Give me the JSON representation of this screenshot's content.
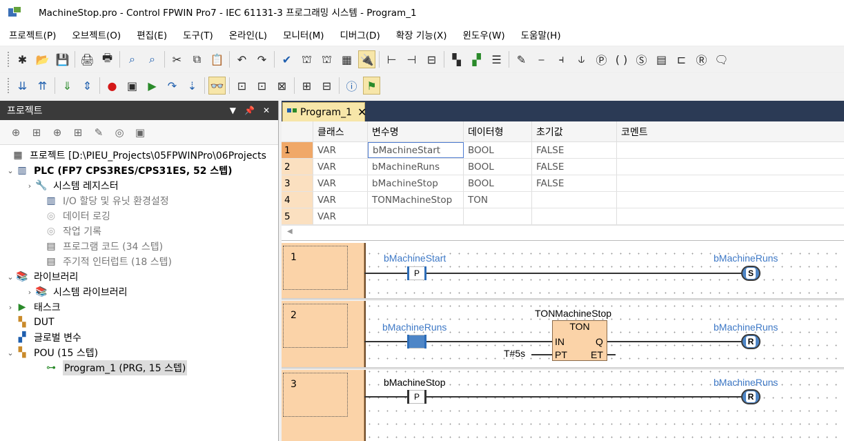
{
  "window": {
    "title": "MachineStop.pro - Control FPWIN Pro7 - IEC 61131-3 프로그래밍 시스템 - Program_1"
  },
  "menu": [
    "프로젝트(P)",
    "오브젝트(O)",
    "편집(E)",
    "도구(T)",
    "온라인(L)",
    "모니터(M)",
    "디버그(D)",
    "확장 기능(X)",
    "윈도우(W)",
    "도움말(H)"
  ],
  "project_panel": {
    "title": "프로젝트",
    "tree": [
      {
        "label": "프로젝트 [D:\\PIEU_Projects\\05FPWINPro\\06Projects",
        "bold": false,
        "icon": "project-icon"
      },
      {
        "label": "PLC (FP7 CPS3RES/CPS31ES, 52 스텝)",
        "bold": true,
        "icon": "plc-icon"
      },
      {
        "label": "시스템 레지스터",
        "bold": false,
        "icon": "wrench-folder-icon"
      },
      {
        "label": "I/O 할당 및 유닛 환경설정",
        "bold": false,
        "icon": "io-icon"
      },
      {
        "label": "데이터 로깅",
        "bold": false,
        "icon": "logging-icon"
      },
      {
        "label": "작업 기록",
        "bold": false,
        "icon": "record-icon"
      },
      {
        "label": "프로그램 코드 (34 스텝)",
        "bold": false,
        "icon": "code-icon"
      },
      {
        "label": "주기적 인터럽트 (18 스텝)",
        "bold": false,
        "icon": "interrupt-icon"
      },
      {
        "label": "라이브러리",
        "bold": false,
        "icon": "library-icon"
      },
      {
        "label": "시스템 라이브러리",
        "bold": false,
        "icon": "library-icon"
      },
      {
        "label": "태스크",
        "bold": false,
        "icon": "task-icon"
      },
      {
        "label": "DUT",
        "bold": false,
        "icon": "dut-icon"
      },
      {
        "label": "글로벌 변수",
        "bold": false,
        "icon": "global-var-icon"
      },
      {
        "label": "POU (15 스텝)",
        "bold": false,
        "icon": "pou-icon"
      },
      {
        "label": "Program_1 (PRG, 15 스텝)",
        "bold": false,
        "icon": "program-icon"
      }
    ]
  },
  "editor": {
    "tab": "Program_1",
    "var_table": {
      "headers": [
        "클래스",
        "변수명",
        "데이터형",
        "초기값",
        "코멘트"
      ],
      "rows": [
        {
          "num": "1",
          "class": "VAR",
          "name": "bMachineStart",
          "type": "BOOL",
          "init": "FALSE",
          "comment": ""
        },
        {
          "num": "2",
          "class": "VAR",
          "name": "bMachineRuns",
          "type": "BOOL",
          "init": "FALSE",
          "comment": ""
        },
        {
          "num": "3",
          "class": "VAR",
          "name": "bMachineStop",
          "type": "BOOL",
          "init": "FALSE",
          "comment": ""
        },
        {
          "num": "4",
          "class": "VAR",
          "name": "TONMachineStop",
          "type": "TON",
          "init": "",
          "comment": ""
        },
        {
          "num": "5",
          "class": "VAR",
          "name": "",
          "type": "",
          "init": "",
          "comment": ""
        }
      ]
    },
    "ladder": {
      "networks": [
        {
          "num": "1",
          "contact_label": "bMachineStart",
          "contact_symbol": "P",
          "coil_label": "bMachineRuns",
          "coil_symbol": "S"
        },
        {
          "num": "2",
          "contact_label": "bMachineRuns",
          "fb_instance": "TONMachineStop",
          "fb_type": "TON",
          "fb_in": "IN",
          "fb_pt": "PT",
          "fb_q": "Q",
          "fb_et": "ET",
          "pt_value": "T#5s",
          "coil_label": "bMachineRuns",
          "coil_symbol": "R"
        },
        {
          "num": "3",
          "contact_label": "bMachineStop",
          "contact_symbol": "P",
          "coil_label": "bMachineRuns",
          "coil_symbol": "R"
        }
      ]
    }
  }
}
